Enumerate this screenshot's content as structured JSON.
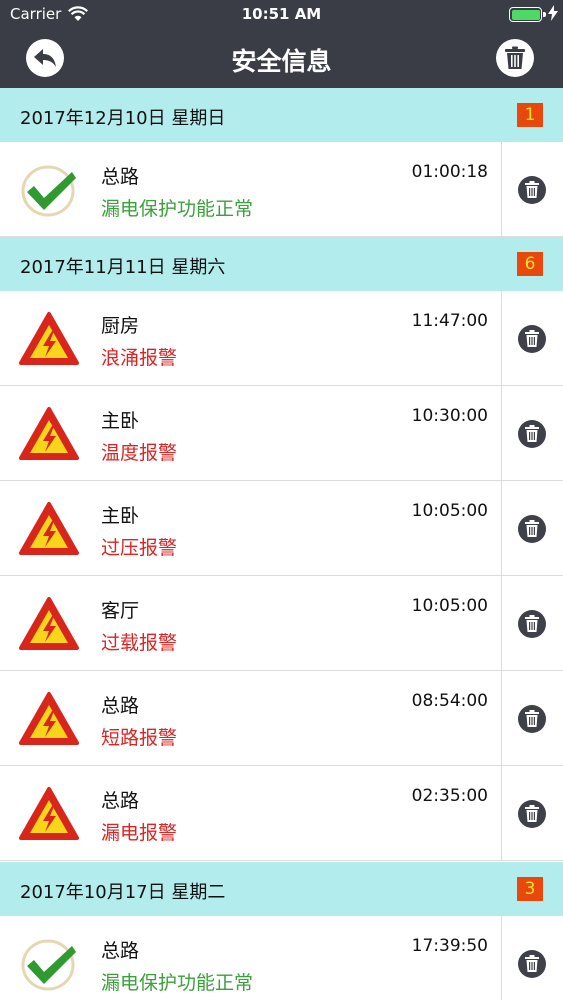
{
  "status_bar": {
    "carrier": "Carrier",
    "time": "10:51 AM",
    "battery_level": 1.0
  },
  "nav": {
    "title": "安全信息",
    "back_icon": "back-arrow-icon",
    "delete_all_icon": "trash-icon"
  },
  "colors": {
    "nav_bg": "#3a3d46",
    "section_bg": "#b3ecec",
    "badge_bg": "#e8480c",
    "badge_text": "#ffe02a",
    "ok_text": "#3ca03c",
    "alarm_text": "#dd2424"
  },
  "sections": [
    {
      "date": "2017年12月10日 星期日",
      "count": "1",
      "items": [
        {
          "name": "总路",
          "time": "01:00:18",
          "status": "漏电保护功能正常",
          "type": "ok"
        }
      ]
    },
    {
      "date": "2017年11月11日 星期六",
      "count": "6",
      "items": [
        {
          "name": "厨房",
          "time": "11:47:00",
          "status": "浪涌报警",
          "type": "alarm"
        },
        {
          "name": "主卧",
          "time": "10:30:00",
          "status": "温度报警",
          "type": "alarm"
        },
        {
          "name": "主卧",
          "time": "10:05:00",
          "status": "过压报警",
          "type": "alarm"
        },
        {
          "name": "客厅",
          "time": "10:05:00",
          "status": "过载报警",
          "type": "alarm"
        },
        {
          "name": "总路",
          "time": "08:54:00",
          "status": "短路报警",
          "type": "alarm"
        },
        {
          "name": "总路",
          "time": "02:35:00",
          "status": "漏电报警",
          "type": "alarm"
        }
      ]
    },
    {
      "date": "2017年10月17日 星期二",
      "count": "3",
      "items": [
        {
          "name": "总路",
          "time": "17:39:50",
          "status": "漏电保护功能正常",
          "type": "ok"
        }
      ]
    }
  ]
}
